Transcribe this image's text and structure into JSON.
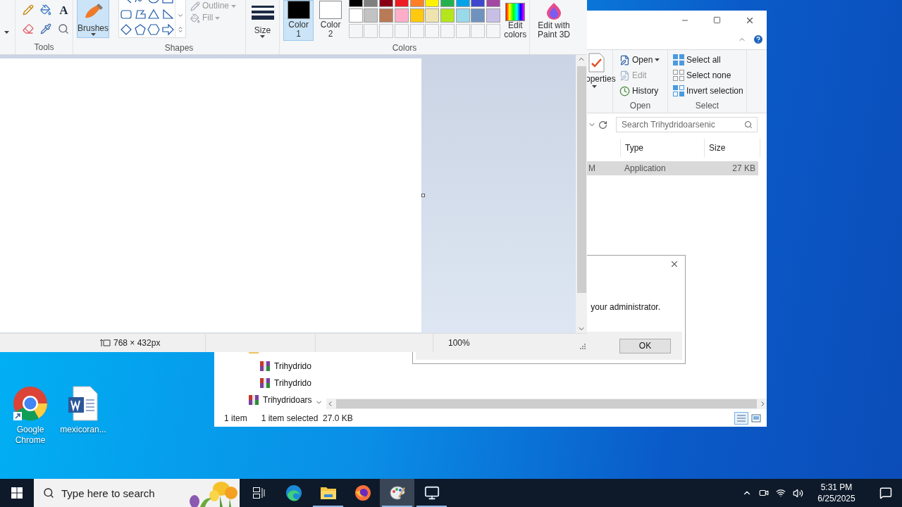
{
  "paint": {
    "ribbon": {
      "tools": {
        "label": "Tools",
        "text_tool": "A"
      },
      "brushes": {
        "label": "Brushes",
        "selected": true
      },
      "shapes": {
        "label": "Shapes",
        "outline": "Outline",
        "fill": "Fill"
      },
      "size": {
        "label": "Size"
      },
      "color1": {
        "label": "Color 1",
        "color": "#000000",
        "selected": true
      },
      "color2": {
        "label": "Color 2",
        "color": "#ffffff",
        "selected": false
      },
      "palette": [
        {
          "color": "#000000"
        },
        {
          "color": "#7f7f7f"
        },
        {
          "color": "#880015"
        },
        {
          "color": "#ed1c24"
        },
        {
          "color": "#ff7f27"
        },
        {
          "color": "#fff200"
        },
        {
          "color": "#22b14c"
        },
        {
          "color": "#00a2e8"
        },
        {
          "color": "#3f48cc"
        },
        {
          "color": "#a349a4"
        },
        {
          "color": "#ffffff"
        },
        {
          "color": "#c3c3c3"
        },
        {
          "color": "#b97a57"
        },
        {
          "color": "#ffaec9"
        },
        {
          "color": "#ffc90e"
        },
        {
          "color": "#efe4b0"
        },
        {
          "color": "#b5e61d"
        },
        {
          "color": "#99d9ea"
        },
        {
          "color": "#7092be"
        },
        {
          "color": "#c8bfe7"
        }
      ],
      "colors_label": "Colors",
      "edit_colors": "Edit colors",
      "paint3d": "Edit with Paint 3D"
    },
    "status": {
      "dimensions": "768 × 432px",
      "zoom": "100%"
    }
  },
  "explorer": {
    "ribbon": {
      "properties": "operties",
      "open_group": "Open",
      "open": "Open",
      "edit": "Edit",
      "history": "History",
      "select_group": "Select",
      "select_all": "Select all",
      "select_none": "Select none",
      "invert": "Invert selection"
    },
    "search": {
      "placeholder": "Search Trihydridoarsenic"
    },
    "columns": [
      "Type",
      "Size"
    ],
    "file_row": {
      "column_1": "M",
      "type": "Application",
      "size": "27 KB",
      "selected": true
    },
    "nav_tree": [
      {
        "kind": "folder",
        "children": [
          {
            "kind": "archive",
            "label": "Trihydrido"
          },
          {
            "kind": "archive",
            "label": "Trihydrido"
          }
        ]
      },
      {
        "kind": "archive",
        "label": "Trihydridoars"
      }
    ],
    "status": {
      "count": "1 item",
      "selection": "1 item selected  27.0 KB"
    }
  },
  "dialog": {
    "message": "your administrator.",
    "ok": "OK"
  },
  "desktop_icons": [
    {
      "kind": "chrome",
      "label": "Google Chrome"
    },
    {
      "kind": "word",
      "label": "mexicoran..."
    }
  ],
  "taskbar": {
    "search_placeholder": "Type here to search",
    "apps": [
      {
        "kind": "taskview",
        "active": false,
        "selected": false
      },
      {
        "kind": "edge",
        "active": false,
        "selected": false
      },
      {
        "kind": "explorer",
        "active": true,
        "selected": false
      },
      {
        "kind": "firefox",
        "active": false,
        "selected": false
      },
      {
        "kind": "paint",
        "active": true,
        "selected": true
      },
      {
        "kind": "monitor",
        "active": true,
        "selected": false
      }
    ],
    "time": "5:31 PM",
    "date": "6/25/2025"
  }
}
